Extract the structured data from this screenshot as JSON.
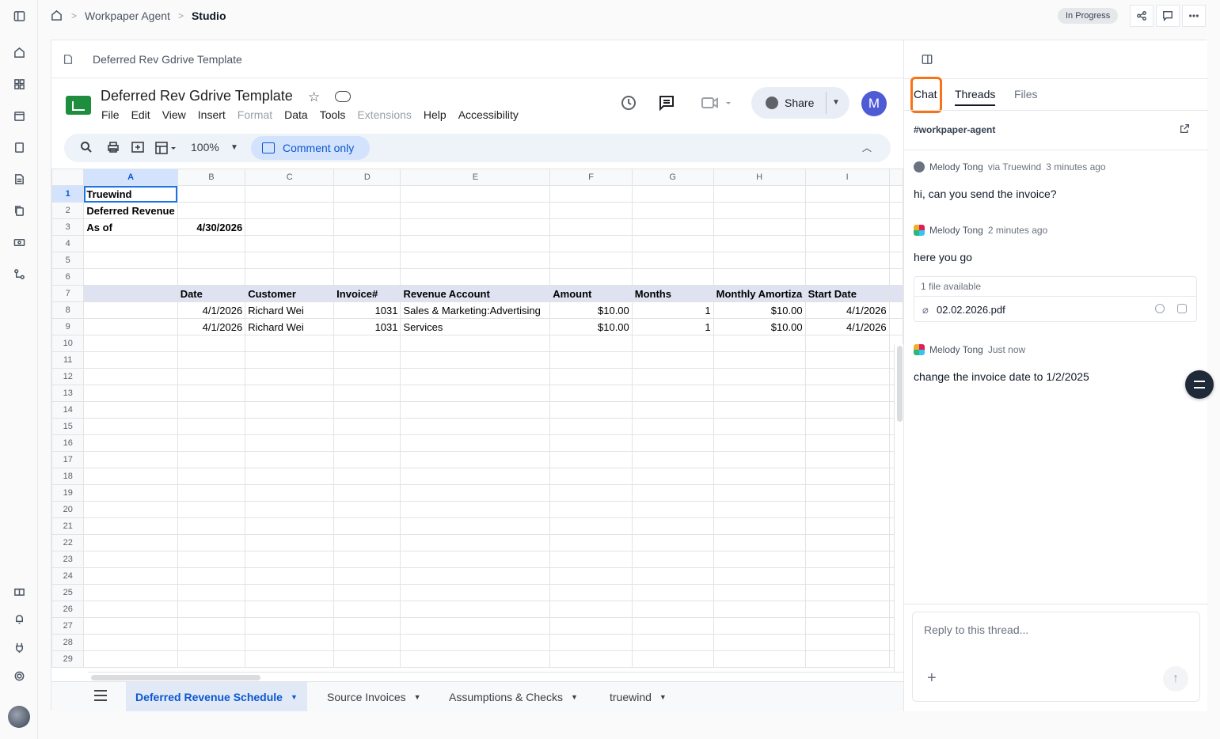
{
  "breadcrumb": {
    "items": [
      "Workpaper Agent",
      "Studio"
    ],
    "status": "In Progress"
  },
  "doc": {
    "header_title": "Deferred Rev Gdrive Template"
  },
  "sheets": {
    "title": "Deferred Rev Gdrive Template",
    "menu": [
      "File",
      "Edit",
      "View",
      "Insert",
      "Format",
      "Data",
      "Tools",
      "Extensions",
      "Help",
      "Accessibility"
    ],
    "menu_dim": [
      "Format",
      "Extensions"
    ],
    "share_label": "Share",
    "user_initial": "M",
    "zoom": "100%",
    "mode": "Comment only",
    "columns": [
      "A",
      "B",
      "C",
      "D",
      "E",
      "F",
      "G",
      "H",
      "I"
    ],
    "rows": [
      [
        "Truewind",
        "",
        "",
        "",
        "",
        "",
        "",
        "",
        ""
      ],
      [
        "Deferred Revenue",
        "",
        "",
        "",
        "",
        "",
        "",
        "",
        ""
      ],
      [
        "As of",
        "4/30/2026",
        "",
        "",
        "",
        "",
        "",
        "",
        ""
      ],
      [
        "",
        "",
        "",
        "",
        "",
        "",
        "",
        "",
        ""
      ],
      [
        "",
        "",
        "",
        "",
        "",
        "",
        "",
        "",
        ""
      ],
      [
        "",
        "",
        "",
        "",
        "",
        "",
        "",
        "",
        ""
      ],
      [
        "",
        "Date",
        "Customer",
        "Invoice#",
        "Revenue Account",
        "Amount",
        "Months",
        "Monthly Amortiza",
        "Start Date"
      ],
      [
        "",
        "4/1/2026",
        "Richard Wei",
        "1031",
        "Sales & Marketing:Advertising",
        "$10.00",
        "1",
        "$10.00",
        "4/1/2026"
      ],
      [
        "",
        "4/1/2026",
        "Richard Wei",
        "1031",
        "Services",
        "$10.00",
        "1",
        "$10.00",
        "4/1/2026"
      ]
    ],
    "total_rows": 29,
    "tabs": [
      "Deferred Revenue Schedule",
      "Source Invoices",
      "Assumptions & Checks",
      "truewind"
    ]
  },
  "chat": {
    "tabs": [
      "Chat",
      "Threads",
      "Files"
    ],
    "active_tab": "Threads",
    "channel": "#workpaper-agent",
    "messages": [
      {
        "author": "Melody Tong",
        "via": "via Truewind",
        "time": "3 minutes ago",
        "text": "hi, can you send the invoice?"
      },
      {
        "author": "Melody Tong",
        "via": "",
        "time": "2 minutes ago",
        "text": "here you go"
      },
      {
        "author": "Melody Tong",
        "via": "",
        "time": "Just now",
        "text": "change the invoice date to 1/2/2025"
      }
    ],
    "file": {
      "available": "1 file available",
      "name": "02.02.2026.pdf"
    },
    "reply_placeholder": "Reply to this thread..."
  }
}
